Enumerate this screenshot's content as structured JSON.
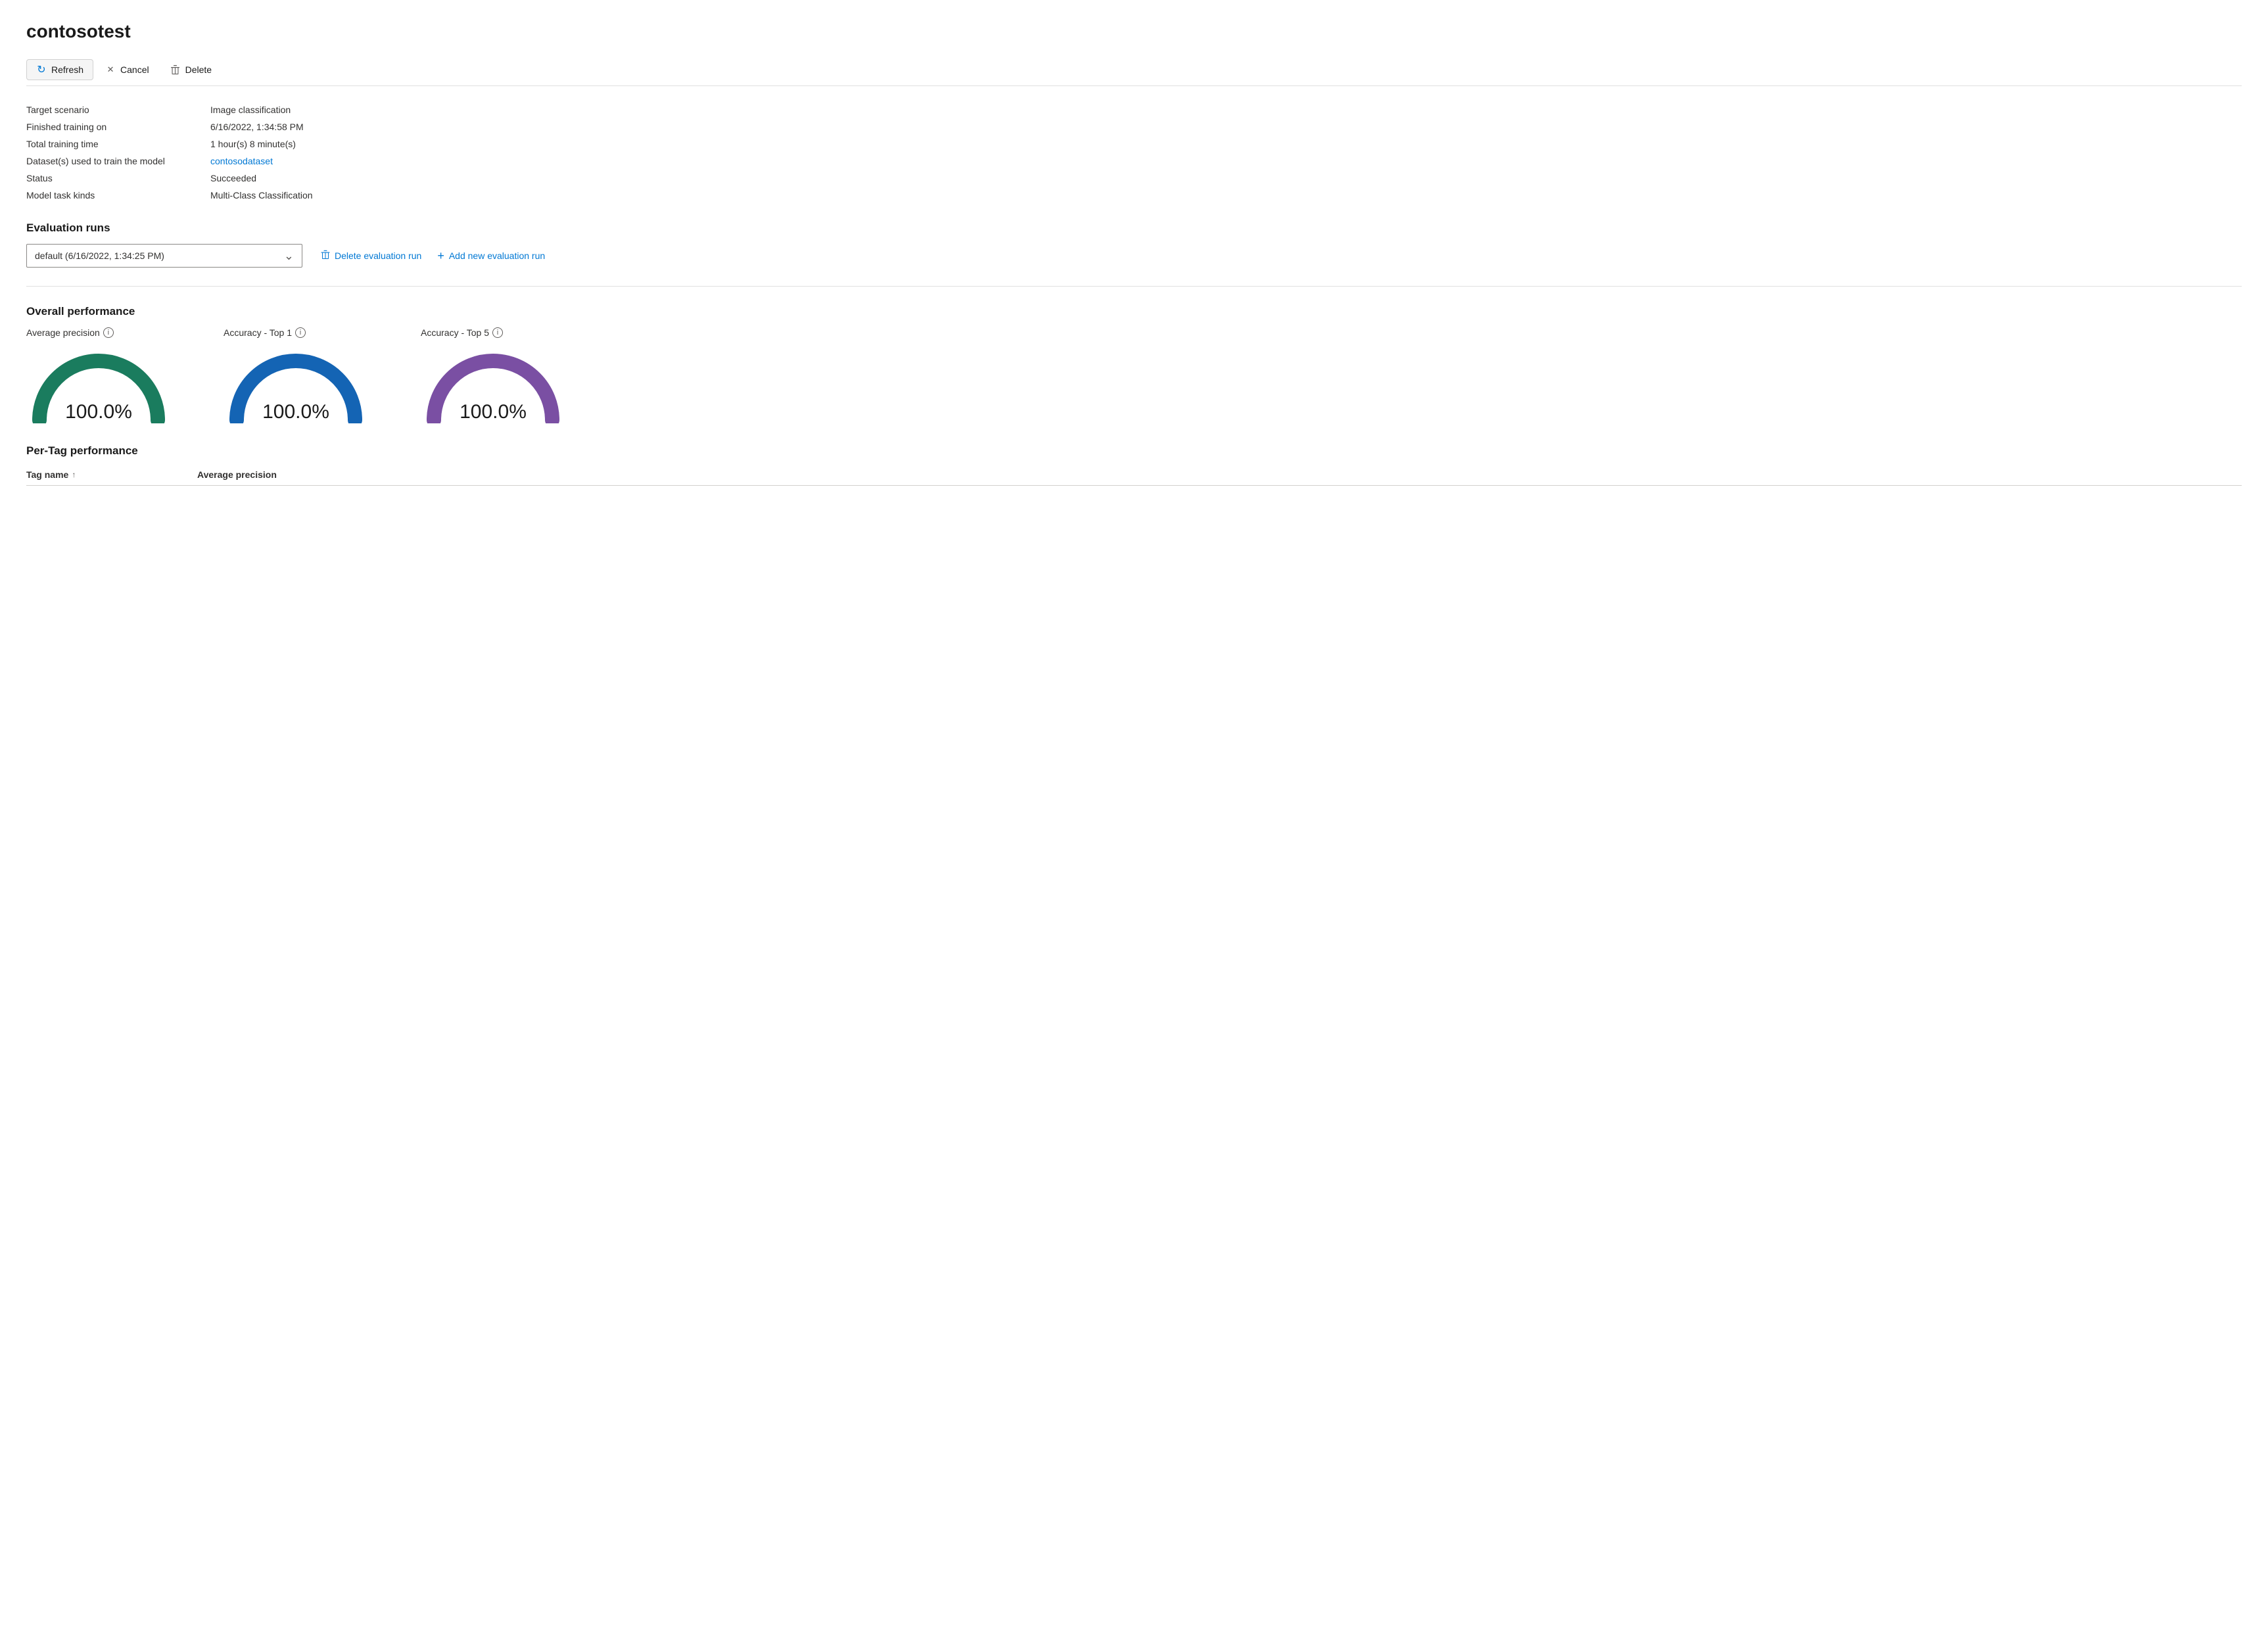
{
  "page": {
    "title": "contosotest"
  },
  "toolbar": {
    "refresh_label": "Refresh",
    "cancel_label": "Cancel",
    "delete_label": "Delete"
  },
  "info": {
    "fields": [
      {
        "label": "Target scenario",
        "value": "Image classification",
        "type": "text"
      },
      {
        "label": "Finished training on",
        "value": "6/16/2022, 1:34:58 PM",
        "type": "text"
      },
      {
        "label": "Total training time",
        "value": "1 hour(s) 8 minute(s)",
        "type": "text"
      },
      {
        "label": "Dataset(s) used to train the model",
        "value": "contosodataset",
        "type": "link"
      },
      {
        "label": "Status",
        "value": "Succeeded",
        "type": "text"
      },
      {
        "label": "Model task kinds",
        "value": "Multi-Class Classification",
        "type": "text"
      }
    ]
  },
  "evaluation_runs": {
    "section_title": "Evaluation runs",
    "dropdown_value": "default (6/16/2022, 1:34:25 PM)",
    "delete_btn": "Delete evaluation run",
    "add_btn": "Add new evaluation run"
  },
  "overall_performance": {
    "section_title": "Overall performance",
    "gauges": [
      {
        "label": "Average precision",
        "value": "100.0%",
        "color": "#1a7c5e"
      },
      {
        "label": "Accuracy - Top 1",
        "value": "100.0%",
        "color": "#1464b4"
      },
      {
        "label": "Accuracy - Top 5",
        "value": "100.0%",
        "color": "#7a4fa3"
      }
    ]
  },
  "per_tag": {
    "section_title": "Per-Tag performance",
    "columns": [
      {
        "label": "Tag name",
        "sortable": true,
        "sort_dir": "asc"
      },
      {
        "label": "Average precision",
        "sortable": false
      }
    ]
  },
  "icons": {
    "refresh": "↻",
    "cancel": "✕",
    "delete": "🗑",
    "chevron_down": "⌄",
    "plus": "+",
    "info": "i"
  }
}
